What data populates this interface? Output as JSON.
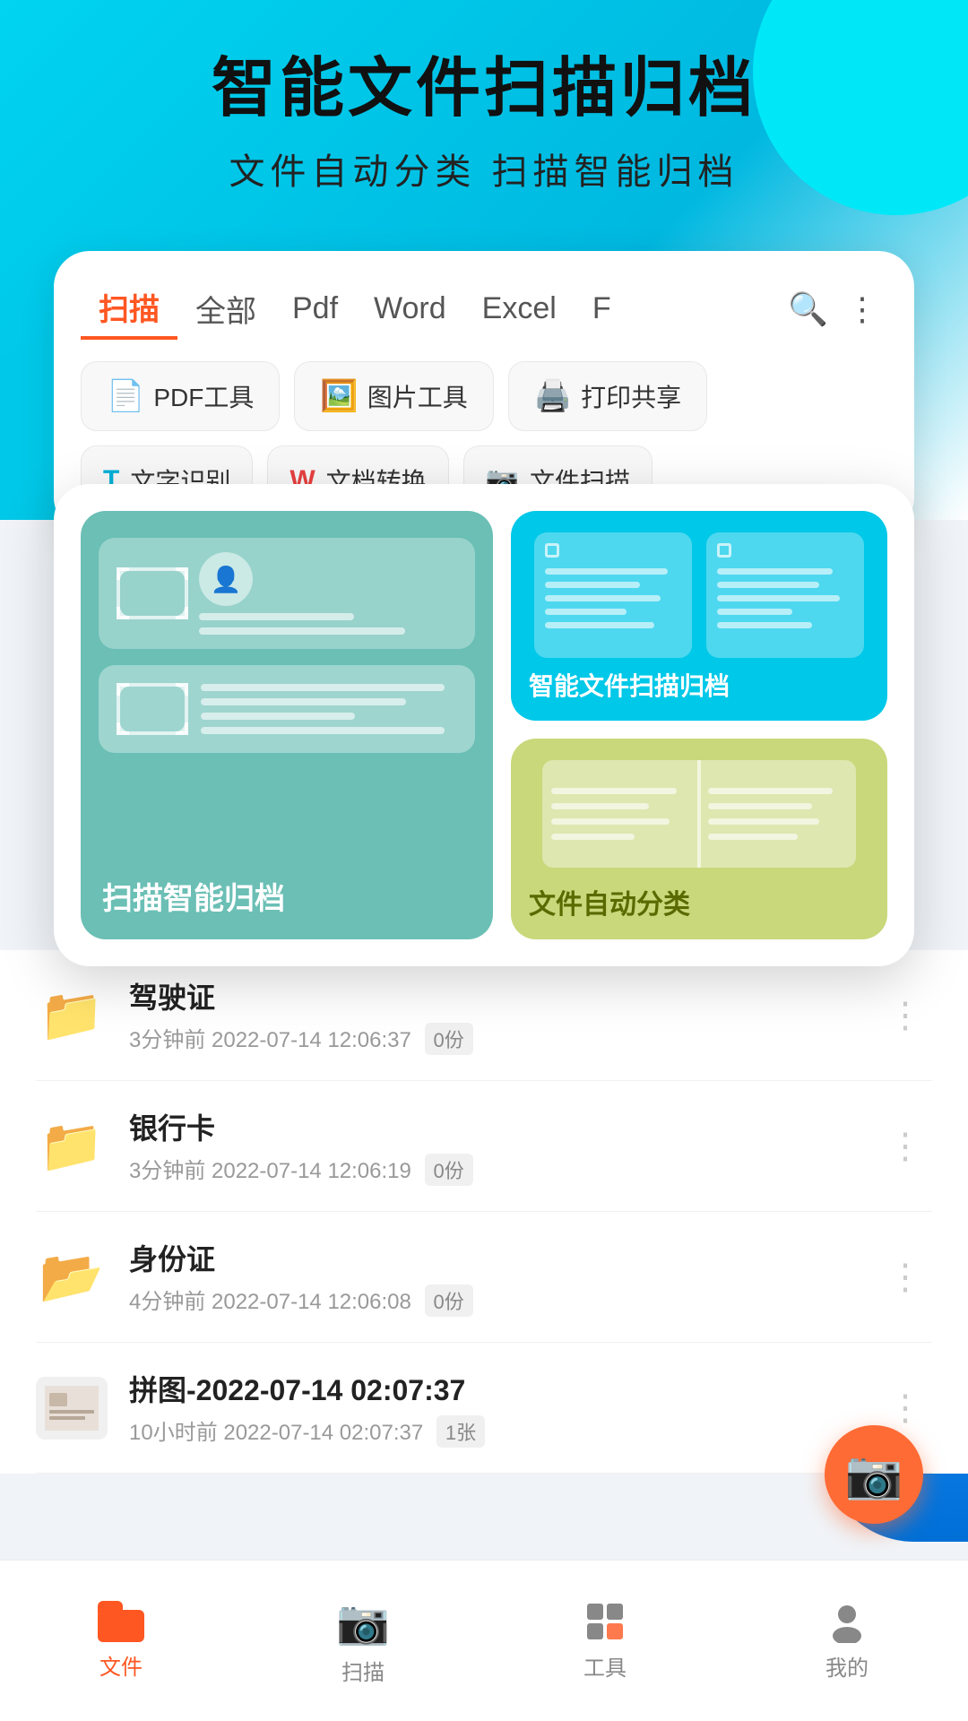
{
  "app": {
    "title": "智能文件扫描归档",
    "subtitle": "文件自动分类   扫描智能归档"
  },
  "tabs": {
    "items": [
      {
        "label": "扫描",
        "active": true
      },
      {
        "label": "全部",
        "active": false
      },
      {
        "label": "Pdf",
        "active": false
      },
      {
        "label": "Word",
        "active": false
      },
      {
        "label": "Excel",
        "active": false
      },
      {
        "label": "F",
        "active": false
      }
    ]
  },
  "tools": [
    {
      "label": "PDF工具",
      "icon": "📄"
    },
    {
      "label": "图片工具",
      "icon": "🖼️"
    },
    {
      "label": "打印共享",
      "icon": "🖨️"
    }
  ],
  "features": [
    {
      "label": "文字识别",
      "icon": "T"
    },
    {
      "label": "文档转换",
      "icon": "W"
    },
    {
      "label": "文件扫描",
      "icon": "📷"
    }
  ],
  "popup": {
    "left_label": "扫描智能归档",
    "right_top_label": "智能文件扫描归档",
    "right_bottom_label": "文件自动分类"
  },
  "files": [
    {
      "name": "驾驶证",
      "meta": "3分钟前  2022-07-14 12:06:37",
      "badge": "0份",
      "type": "folder",
      "color": "#f5b800"
    },
    {
      "name": "银行卡",
      "meta": "3分钟前  2022-07-14 12:06:19",
      "badge": "0份",
      "type": "folder",
      "color": "#f5b800"
    },
    {
      "name": "身份证",
      "meta": "4分钟前  2022-07-14 12:06:08",
      "badge": "0份",
      "type": "folder",
      "color": "#f5b800"
    },
    {
      "name": "拼图-2022-07-14 02:07:37",
      "meta": "10小时前  2022-07-14 02:07:37",
      "badge": "1张",
      "type": "image",
      "color": "#e0e0e0"
    }
  ],
  "nav": {
    "items": [
      {
        "label": "文件",
        "icon": "folder",
        "active": true
      },
      {
        "label": "扫描",
        "icon": "camera",
        "active": false
      },
      {
        "label": "工具",
        "icon": "grid",
        "active": false
      },
      {
        "label": "我的",
        "icon": "person",
        "active": false
      }
    ]
  }
}
